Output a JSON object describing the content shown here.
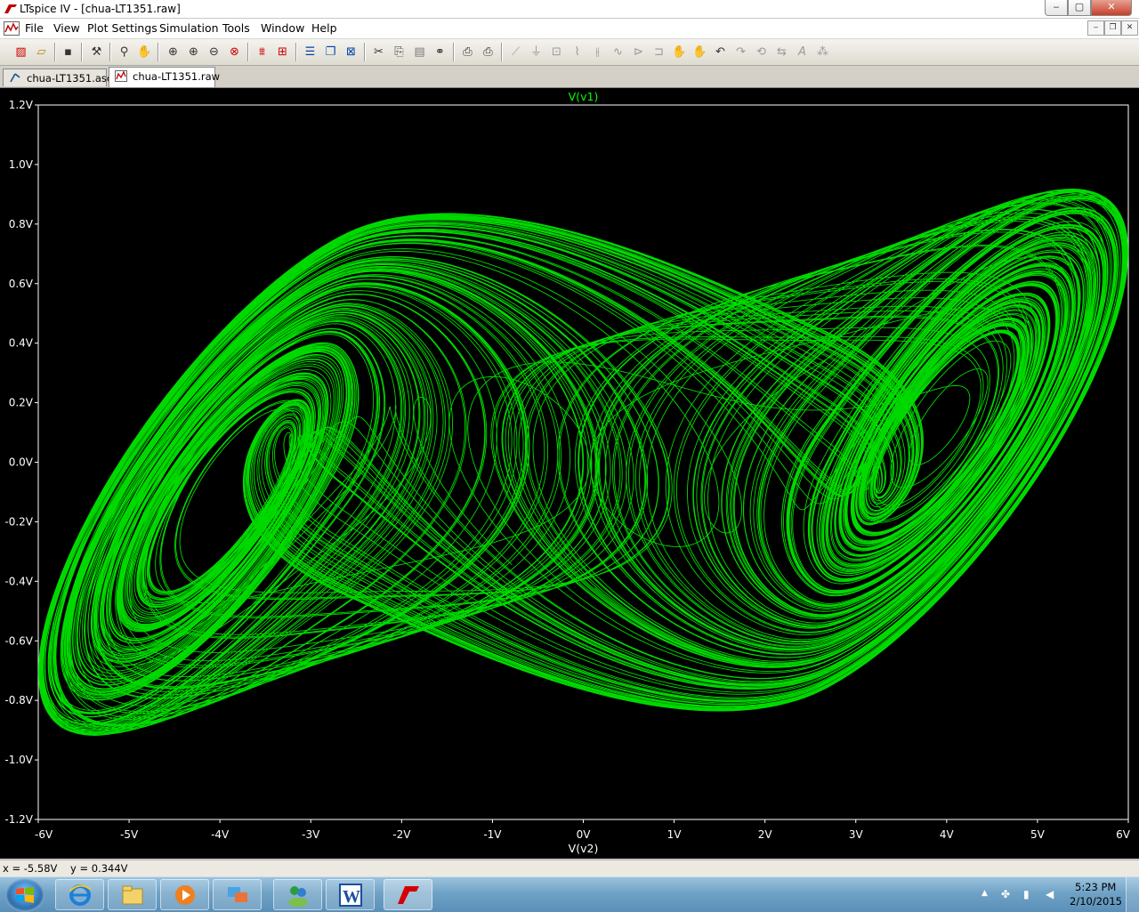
{
  "window": {
    "title": "LTspice IV - [chua-LT1351.raw]"
  },
  "window_controls": {
    "minimize": "‒",
    "maximize": "▢",
    "close": "✕"
  },
  "menu": {
    "items": [
      "File",
      "View",
      "Plot Settings",
      "Simulation",
      "Tools",
      "Window",
      "Help"
    ]
  },
  "mdi_controls": {
    "minimize": "‒",
    "restore": "❐",
    "close": "✕"
  },
  "toolbar": {
    "icons": [
      "new-schematic-icon",
      "open-icon",
      "save-icon",
      "control-panel-icon",
      "run-icon",
      "halt-icon",
      "zoom-area-icon",
      "zoom-in-icon",
      "zoom-out-icon",
      "zoom-cancel-icon",
      "autorange-icon",
      "fit-icon",
      "tile-horizontal-icon",
      "cascade-icon",
      "close-window-icon",
      "cut-icon",
      "copy-icon",
      "paste-icon",
      "find-icon",
      "print-preview-icon",
      "print-icon",
      "wire-icon",
      "ground-icon",
      "label-icon",
      "resistor-icon",
      "capacitor-icon",
      "inductor-icon",
      "diode-icon",
      "component-icon",
      "move-icon",
      "drag-icon",
      "undo-icon",
      "redo-icon",
      "rotate-icon",
      "mirror-icon",
      "text-icon",
      "spice-directive-icon"
    ]
  },
  "tabs": [
    {
      "label": "chua-LT1351.asc",
      "icon": "schematic-icon",
      "active": false
    },
    {
      "label": "chua-LT1351.raw",
      "icon": "waveform-icon",
      "active": true
    }
  ],
  "plot": {
    "trace_title": "V(v1)",
    "x_axis_label": "V(v2)",
    "x_ticks": [
      "-6V",
      "-5V",
      "-4V",
      "-3V",
      "-2V",
      "-1V",
      "0V",
      "1V",
      "2V",
      "3V",
      "4V",
      "5V",
      "6V"
    ],
    "y_ticks": [
      "1.2V",
      "1.0V",
      "0.8V",
      "0.6V",
      "0.4V",
      "0.2V",
      "0.0V",
      "-0.2V",
      "-0.4V",
      "-0.6V",
      "-0.8V",
      "-1.0V",
      "-1.2V"
    ],
    "trace_color": "#00ff00",
    "background_color": "#000000"
  },
  "chart_data": {
    "type": "line",
    "title": "V(v1)",
    "xlabel": "V(v2)",
    "ylabel": "",
    "xlim": [
      -6,
      6
    ],
    "ylim": [
      -1.2,
      1.2
    ],
    "grid": false,
    "series": [
      {
        "name": "V(v1)",
        "description_points_x": [
          -5.8,
          -4.9,
          -3.4,
          -1.5,
          0.2,
          2.0,
          3.6,
          5.4,
          5.9,
          5.0,
          3.0,
          1.0,
          -1.0,
          -3.0,
          -5.0
        ],
        "description_points_y": [
          -0.45,
          0.25,
          0.88,
          1.12,
          0.98,
          0.8,
          0.85,
          0.75,
          0.35,
          -0.45,
          -0.95,
          -1.12,
          -0.98,
          -0.82,
          -0.85
        ]
      }
    ]
  },
  "status": {
    "cursor_readout": "x = -5.58V    y = 0.344V"
  },
  "taskbar": {
    "apps": [
      "internet-explorer-icon",
      "file-explorer-icon",
      "media-player-icon",
      "windows-icon",
      "messenger-icon",
      "word-icon",
      "ltspice-icon"
    ],
    "tray_up_arrow": "▲",
    "clock_time": "5:23 PM",
    "clock_date": "2/10/2015"
  }
}
